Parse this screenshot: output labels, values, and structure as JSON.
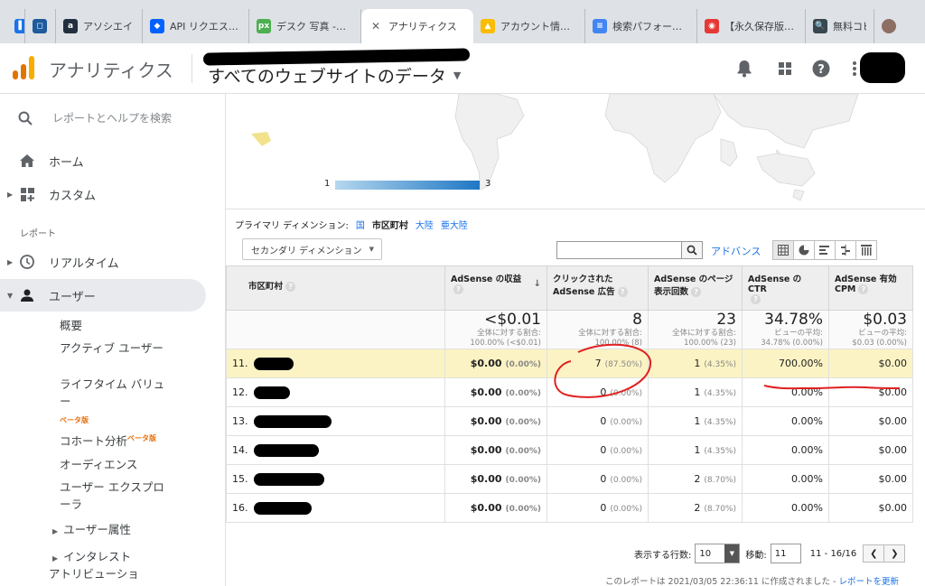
{
  "browser": {
    "tabs": [
      {
        "label": "",
        "icon": "bookmark-icon",
        "color": "#1a73e8"
      },
      {
        "label": "",
        "icon": "square-icon",
        "color": "#1e5a9c"
      },
      {
        "label": "アソシエイト・",
        "icon": "amazon-icon",
        "color": "#232f3e"
      },
      {
        "label": "API リクエス…",
        "icon": "dropbox-icon",
        "color": "#0061ff"
      },
      {
        "label": "デスク 写真 -…",
        "icon": "px-icon",
        "color": "#4caf50"
      },
      {
        "label": "アナリティクス",
        "icon": "close-icon",
        "color": "#5f6368"
      },
      {
        "label": "アカウント情…",
        "icon": "adsense-icon",
        "color": "#fbbc04"
      },
      {
        "label": "検索パフォー…",
        "icon": "search-console-icon",
        "color": "#4285f4"
      },
      {
        "label": "【永久保存版…",
        "icon": "site-icon",
        "color": "#e53935"
      },
      {
        "label": "無料コピ",
        "icon": "magnifier-icon",
        "color": "#37474f"
      },
      {
        "label": "",
        "icon": "avatar-icon",
        "color": "#8d6e63"
      }
    ]
  },
  "header": {
    "app_title": "アナリティクス",
    "view_name": "すべてのウェブサイトのデータ"
  },
  "sidebar": {
    "search_placeholder": "レポートとヘルプを検索",
    "home": "ホーム",
    "custom": "カスタム",
    "reports_label": "レポート",
    "realtime": "リアルタイム",
    "users": "ユーザー",
    "sub": {
      "overview": "概要",
      "active_users": "アクティブ ユーザー",
      "lifetime_value": "ライフタイム バリュー",
      "beta1": "ベータ版",
      "cohort": "コホート分析",
      "beta2": "ベータ版",
      "audiences": "オーディエンス",
      "user_explorer": "ユーザー エクスプローラ",
      "user_attributes": "ユーザー属性",
      "interests": "インタレスト",
      "attribution": "アトリビューショ"
    }
  },
  "map": {
    "legend_min": "1",
    "legend_max": "3",
    "legend_colors": [
      "#b5d7ee",
      "#1f77c4"
    ]
  },
  "primary_dimension": {
    "label": "プライマリ ディメンション:",
    "options": [
      "国",
      "市区町村",
      "大陸",
      "亜大陸"
    ],
    "selected": "市区町村"
  },
  "secondary_dimension": "セカンダリ ディメンション",
  "advanced_label": "アドバンス",
  "table": {
    "headers": {
      "city": "市区町村",
      "revenue": "AdSense の収益",
      "clicks": "クリックされた AdSense 広告",
      "pageviews": "AdSense のページ表示回数",
      "ctr": "AdSense の CTR",
      "ecpm": "AdSense 有効 CPM"
    },
    "totals": {
      "revenue": "<$0.01",
      "revenue_sub": "全体に対する割合: 100.00% (<$0.01)",
      "clicks": "8",
      "clicks_sub": "全体に対する割合: 100.00% (8)",
      "pageviews": "23",
      "pageviews_sub": "全体に対する割合: 100.00% (23)",
      "ctr": "34.78%",
      "ctr_sub": "ビューの平均: 34.78% (0.00%)",
      "ecpm": "$0.03",
      "ecpm_sub": "ビューの平均: $0.03 (0.00%)"
    },
    "rows": [
      {
        "n": "11.",
        "revenue": "$0.00",
        "revenue_pct": "(0.00%)",
        "clicks": "7",
        "clicks_pct": "(87.50%)",
        "pv": "1",
        "pv_pct": "(4.35%)",
        "ctr": "700.00%",
        "ecpm": "$0.00"
      },
      {
        "n": "12.",
        "revenue": "$0.00",
        "revenue_pct": "(0.00%)",
        "clicks": "0",
        "clicks_pct": "(0.00%)",
        "pv": "1",
        "pv_pct": "(4.35%)",
        "ctr": "0.00%",
        "ecpm": "$0.00"
      },
      {
        "n": "13.",
        "revenue": "$0.00",
        "revenue_pct": "(0.00%)",
        "clicks": "0",
        "clicks_pct": "(0.00%)",
        "pv": "1",
        "pv_pct": "(4.35%)",
        "ctr": "0.00%",
        "ecpm": "$0.00"
      },
      {
        "n": "14.",
        "revenue": "$0.00",
        "revenue_pct": "(0.00%)",
        "clicks": "0",
        "clicks_pct": "(0.00%)",
        "pv": "1",
        "pv_pct": "(4.35%)",
        "ctr": "0.00%",
        "ecpm": "$0.00"
      },
      {
        "n": "15.",
        "revenue": "$0.00",
        "revenue_pct": "(0.00%)",
        "clicks": "0",
        "clicks_pct": "(0.00%)",
        "pv": "2",
        "pv_pct": "(8.70%)",
        "ctr": "0.00%",
        "ecpm": "$0.00"
      },
      {
        "n": "16.",
        "revenue": "$0.00",
        "revenue_pct": "(0.00%)",
        "clicks": "0",
        "clicks_pct": "(0.00%)",
        "pv": "2",
        "pv_pct": "(8.70%)",
        "ctr": "0.00%",
        "ecpm": "$0.00"
      }
    ]
  },
  "pager": {
    "rows_label": "表示する行数:",
    "rows_value": "10",
    "goto_label": "移動:",
    "goto_value": "11",
    "range": "11 - 16/16"
  },
  "footer": {
    "created_text": "このレポートは 2021/03/05 22:36:11 に作成されました -",
    "refresh_link": "レポートを更新"
  },
  "colors": {
    "accent_blue": "#1a73e8",
    "highlight_row": "#fcf3c4",
    "annotation_red": "#e02020"
  }
}
